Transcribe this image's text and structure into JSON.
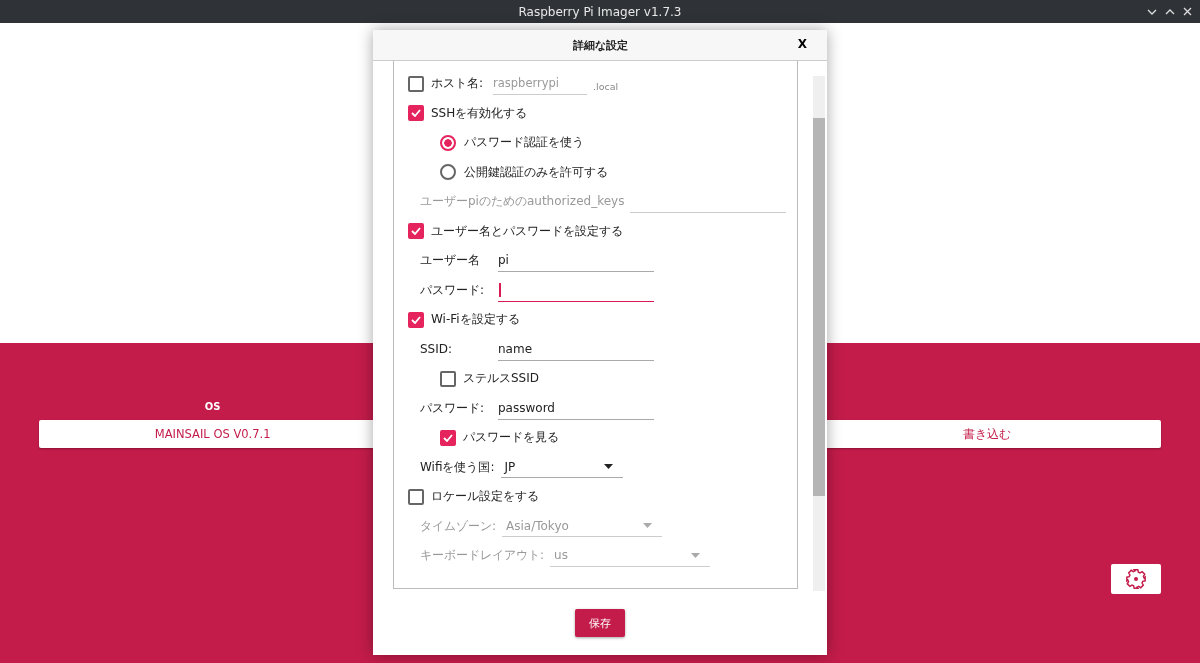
{
  "window": {
    "title": "Raspberry Pi Imager v1.7.3"
  },
  "main": {
    "os_label": "OS",
    "os_button": "MAINSAIL OS V0.7.1",
    "write_button": "書き込む"
  },
  "dialog": {
    "title": "詳細な設定",
    "close": "X",
    "sections": [
      {
        "kind": "checkbox",
        "label": "ホスト名:",
        "checked": false,
        "field": {
          "value": "raspberrypi",
          "disabled": true
        },
        "suffix": ".local"
      },
      {
        "kind": "checkbox",
        "label": "SSHを有効化する",
        "checked": true,
        "children": [
          {
            "kind": "radio",
            "label": "パスワード認証を使う",
            "selected": true
          },
          {
            "kind": "radio",
            "label": "公開鍵認証のみを許可する",
            "selected": false
          },
          {
            "kind": "field",
            "label": "ユーザーpiのためのauthorized_keys",
            "disabled": true
          }
        ]
      },
      {
        "kind": "checkbox",
        "label": "ユーザー名とパスワードを設定する",
        "checked": true,
        "children": [
          {
            "kind": "field",
            "label": "ユーザー名",
            "value": "pi"
          },
          {
            "kind": "field",
            "label": "パスワード:",
            "focused": true
          }
        ]
      },
      {
        "kind": "checkbox",
        "label": "Wi-Fiを設定する",
        "checked": true,
        "children": [
          {
            "kind": "field",
            "label": "SSID:",
            "value": "name"
          },
          {
            "kind": "checkbox",
            "label": "ステルスSSID",
            "checked": false
          },
          {
            "kind": "field",
            "label": "パスワード:",
            "value": "password"
          },
          {
            "kind": "checkbox",
            "label": "パスワードを見る",
            "checked": true
          },
          {
            "kind": "select",
            "label": "Wifiを使う国:",
            "value": "JP"
          }
        ]
      },
      {
        "kind": "checkbox",
        "label": "ロケール設定をする",
        "checked": false,
        "children": [
          {
            "kind": "select",
            "label": "タイムゾーン:",
            "value": "Asia/Tokyo",
            "disabled": true
          },
          {
            "kind": "select",
            "label": "キーボードレイアウト:",
            "value": "us",
            "disabled": true
          }
        ]
      }
    ],
    "save": "保存"
  }
}
